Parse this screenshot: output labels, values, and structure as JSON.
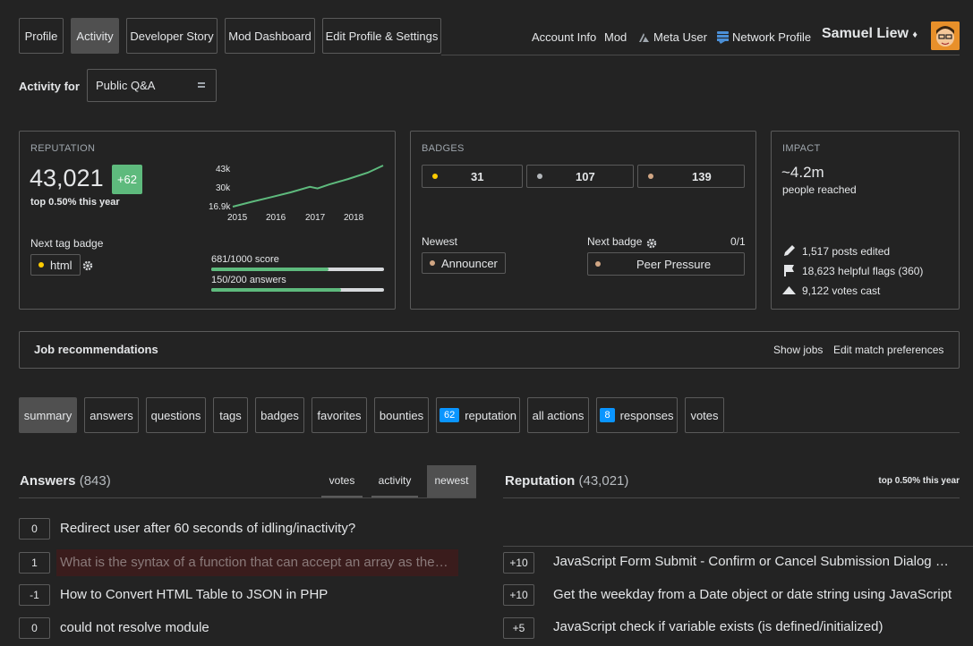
{
  "nav": {
    "tabs": [
      "Profile",
      "Activity",
      "Developer Story",
      "Mod Dashboard",
      "Edit Profile & Settings"
    ],
    "right_links": {
      "account_info": "Account Info",
      "mod": "Mod",
      "meta_user": "Meta User",
      "network_profile": "Network Profile"
    },
    "user_name": "Samuel Liew",
    "mod_diamond": "♦"
  },
  "activity_for": {
    "label": "Activity for",
    "selected": "Public Q&A"
  },
  "reputation_panel": {
    "title": "REPUTATION",
    "value": "43,021",
    "change": "+62",
    "rank": "top 0.50% this year",
    "next_tag_badge_label": "Next tag badge",
    "next_tag": "html",
    "score_progress": {
      "text": "681/1000 score",
      "fraction": 0.681
    },
    "answers_progress": {
      "text": "150/200 answers",
      "fraction": 0.75
    }
  },
  "chart_data": {
    "type": "line",
    "title": "",
    "x_tick_labels": [
      "2015",
      "2016",
      "2017",
      "2018"
    ],
    "y_tick_labels": [
      "43k",
      "30k",
      "16.9k"
    ],
    "ylim": [
      16900,
      43021
    ],
    "series": [
      {
        "values": [
          [
            2015.0,
            16900
          ],
          [
            2015.5,
            20000
          ],
          [
            2016.0,
            23000
          ],
          [
            2016.5,
            26000
          ],
          [
            2017.0,
            29500
          ],
          [
            2017.2,
            28500
          ],
          [
            2017.5,
            31000
          ],
          [
            2018.0,
            34500
          ],
          [
            2018.5,
            38500
          ],
          [
            2018.9,
            43021
          ]
        ]
      }
    ],
    "xlim": [
      2015.0,
      2018.9
    ],
    "color": "#5eba7d"
  },
  "badges_panel": {
    "title": "BADGES",
    "gold": "31",
    "silver": "107",
    "bronze": "139",
    "newest_label": "Newest",
    "newest_badge": "Announcer",
    "next_badge_label": "Next badge",
    "next_badge_progress": "0/1",
    "next_badge": "Peer Pressure"
  },
  "impact_panel": {
    "title": "IMPACT",
    "reached": "~4.2m",
    "reached_label": "people reached",
    "posts_edited": "1,517 posts edited",
    "helpful_flags": "18,623 helpful flags (360)",
    "votes_cast": "9,122 votes cast"
  },
  "jobs": {
    "title": "Job recommendations",
    "show_jobs": "Show jobs",
    "edit_prefs": "Edit match preferences"
  },
  "sub_tabs": [
    {
      "label": "summary"
    },
    {
      "label": "answers"
    },
    {
      "label": "questions"
    },
    {
      "label": "tags"
    },
    {
      "label": "badges"
    },
    {
      "label": "favorites"
    },
    {
      "label": "bounties"
    },
    {
      "label": "reputation",
      "count": "62"
    },
    {
      "label": "all actions"
    },
    {
      "label": "responses",
      "count": "8"
    },
    {
      "label": "votes"
    }
  ],
  "answers_section": {
    "title": "Answers",
    "count": "(843)",
    "sort_tabs": [
      "votes",
      "activity",
      "newest"
    ],
    "items": [
      {
        "score": "0",
        "title": "Redirect user after 60 seconds of idling/inactivity?"
      },
      {
        "score": "1",
        "title": "What is the syntax of a function that can accept an array as the argument?"
      },
      {
        "score": "-1",
        "title": "How to Convert HTML Table to JSON in PHP"
      },
      {
        "score": "0",
        "title": "could not resolve module"
      }
    ]
  },
  "reputation_section": {
    "title": "Reputation",
    "count": "(43,021)",
    "rank": "top 0.50% this year",
    "items": [
      {
        "score": "+10",
        "title": "JavaScript Form Submit - Confirm or Cancel Submission Dialog Box"
      },
      {
        "score": "+10",
        "title": "Get the weekday from a Date object or date string using JavaScript"
      },
      {
        "score": "+5",
        "title": "JavaScript check if variable exists (is defined/initialized)"
      }
    ]
  },
  "colors": {
    "background": "#232323",
    "accent_green": "#5eba7d",
    "count_blue": "#0a95ff",
    "highlight_row": "#3a1c1c"
  }
}
